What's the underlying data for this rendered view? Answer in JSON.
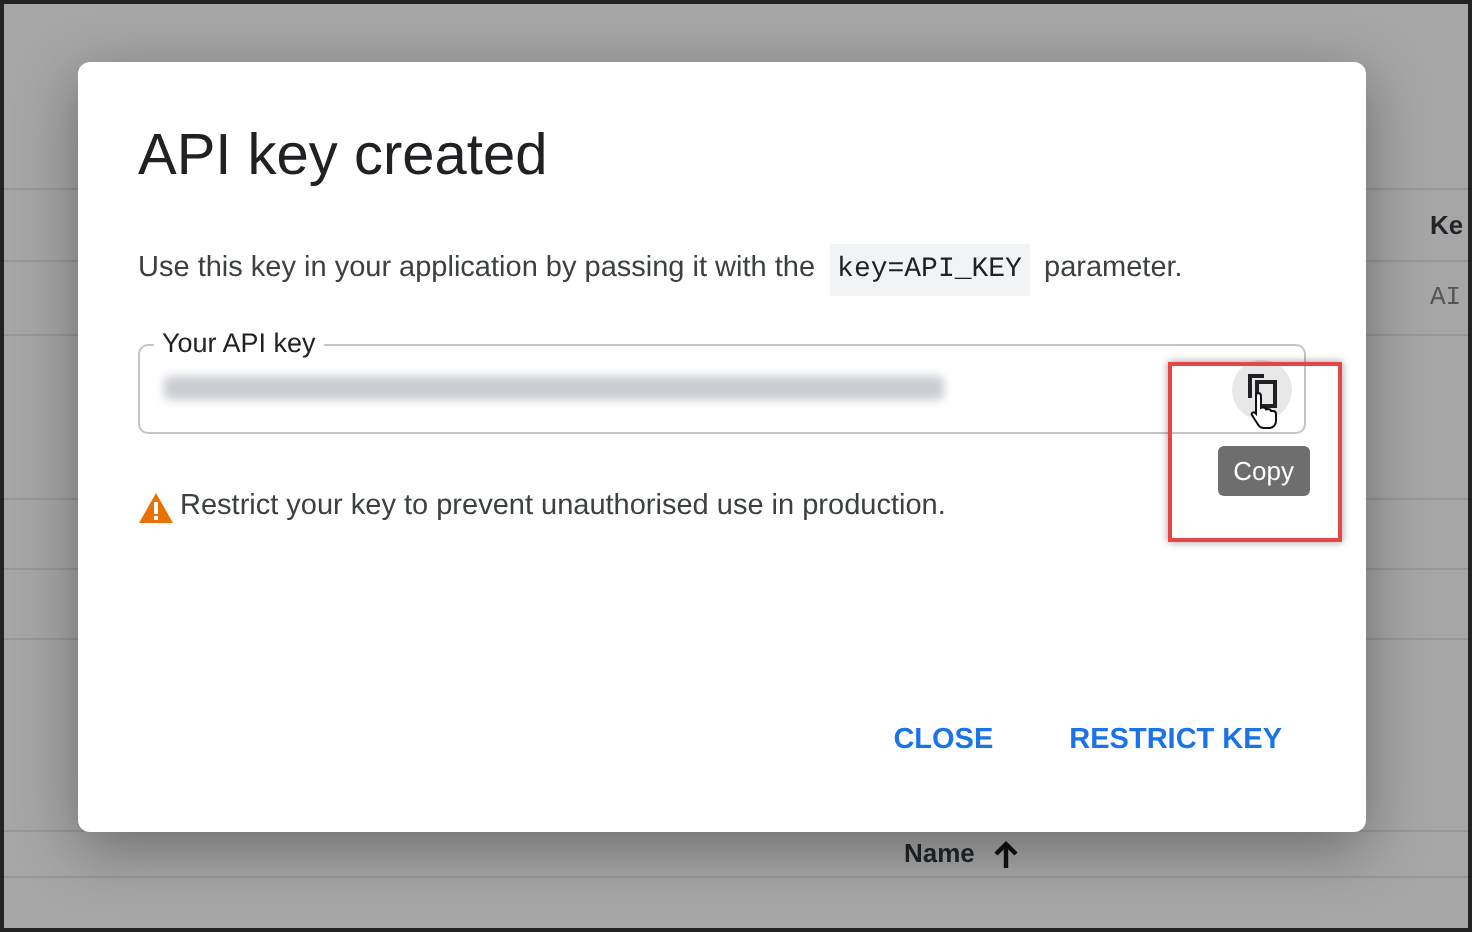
{
  "background": {
    "header_cell": "Ke",
    "key_cell": "AI",
    "sort_header": {
      "label": "Name"
    }
  },
  "dialog": {
    "title": "API key created",
    "description": [
      {
        "kind": "text",
        "text": "Use this key in your application by passing it with the"
      },
      {
        "kind": "code",
        "text": "key=API_KEY"
      },
      {
        "kind": "text",
        "text": "parameter."
      }
    ],
    "key_field": {
      "label": "Your API key",
      "value_hidden": true
    },
    "copy_button": {
      "tooltip": "Copy",
      "highlighted": true
    },
    "warning": "Restrict your key to prevent unauthorised use in production.",
    "buttons": [
      "CLOSE",
      "RESTRICT KEY"
    ]
  }
}
